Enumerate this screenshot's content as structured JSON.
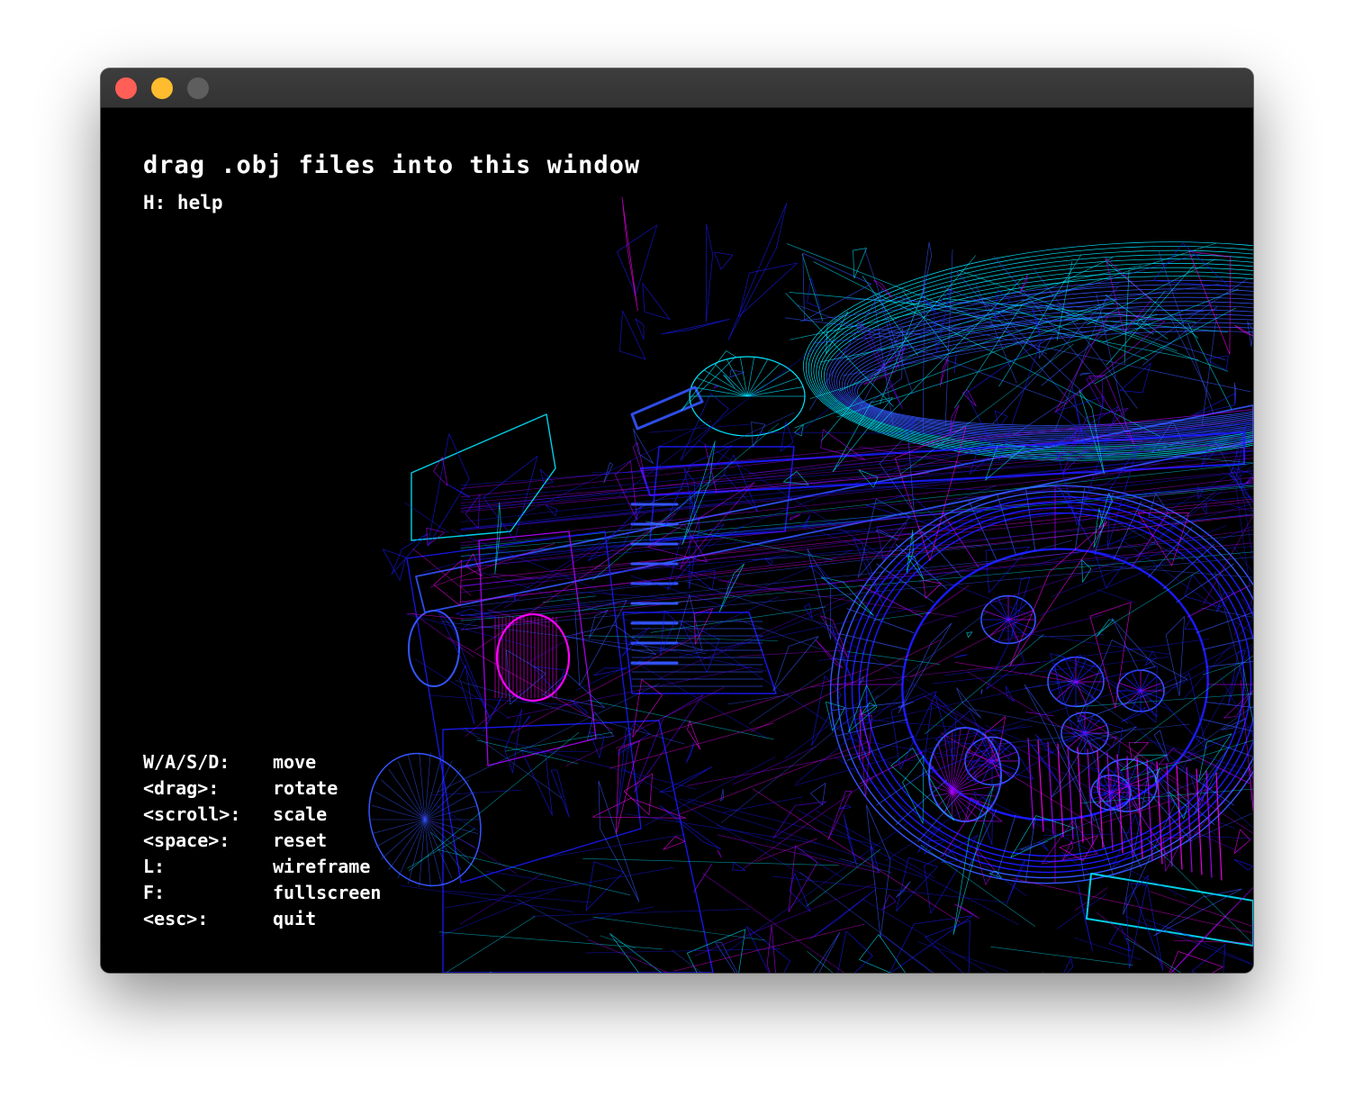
{
  "window": {
    "controls": {
      "close_color": "#ff5f57",
      "minimize_color": "#febc2e",
      "zoom_color": "#5e5e5e"
    }
  },
  "viewer": {
    "drop_hint": "drag .obj files into this window",
    "help_hint": "H: help",
    "controls": [
      {
        "key": "W/A/S/D:",
        "action": "move"
      },
      {
        "key": "<drag>:",
        "action": "rotate"
      },
      {
        "key": "<scroll>:",
        "action": "scale"
      },
      {
        "key": "<space>:",
        "action": "reset"
      },
      {
        "key": "L:",
        "action": "wireframe"
      },
      {
        "key": "F:",
        "action": "fullscreen"
      },
      {
        "key": "<esc>:",
        "action": "quit"
      }
    ],
    "model": {
      "render_mode": "wireframe",
      "palette": [
        "#1a1aff",
        "#3355ff",
        "#00e5ff",
        "#b000ff",
        "#ff00ff",
        "#6a00ff"
      ]
    }
  }
}
